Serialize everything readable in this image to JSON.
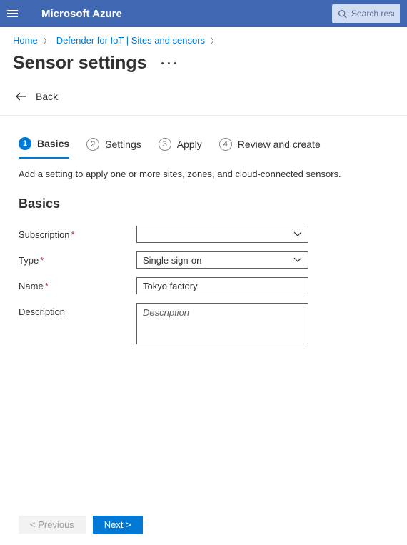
{
  "header": {
    "brand": "Microsoft Azure",
    "search_placeholder": "Search resou"
  },
  "breadcrumb": {
    "items": [
      "Home",
      "Defender for IoT | Sites and sensors"
    ]
  },
  "page": {
    "title": "Sensor settings",
    "back_label": "Back"
  },
  "tabs": [
    {
      "num": "1",
      "label": "Basics"
    },
    {
      "num": "2",
      "label": "Settings"
    },
    {
      "num": "3",
      "label": "Apply"
    },
    {
      "num": "4",
      "label": "Review and create"
    }
  ],
  "intro": "Add a setting to apply one or more sites, zones, and cloud-connected sensors.",
  "section_heading": "Basics",
  "form": {
    "subscription": {
      "label": "Subscription",
      "value": ""
    },
    "type": {
      "label": "Type",
      "value": "Single sign-on"
    },
    "name": {
      "label": "Name",
      "value": "Tokyo factory"
    },
    "description": {
      "label": "Description",
      "placeholder": "Description",
      "value": ""
    }
  },
  "footer": {
    "prev": "< Previous",
    "next": "Next >"
  }
}
